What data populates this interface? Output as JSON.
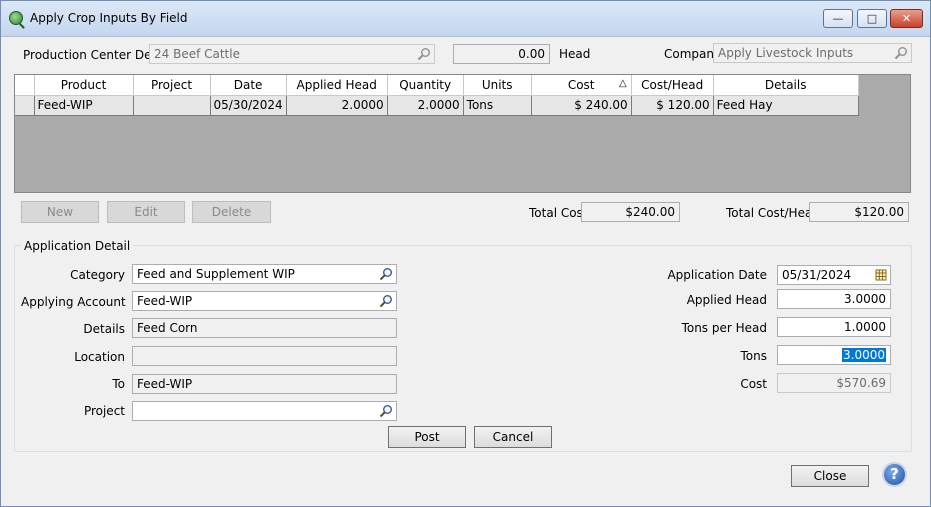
{
  "window": {
    "title": "Apply Crop Inputs By Field"
  },
  "header": {
    "production_center_label": "Production Center Detail",
    "production_center_value": "24 Beef Cattle",
    "head_value": "0.00",
    "head_label": "Head",
    "company_label": "Company",
    "company_value": "Apply Livestock Inputs"
  },
  "grid": {
    "columns": [
      "Product",
      "Project",
      "Date",
      "Applied Head",
      "Quantity",
      "Units",
      "Cost",
      "Cost/Head",
      "Details"
    ],
    "rows": [
      [
        "Feed-WIP",
        "",
        "05/30/2024",
        "2.0000",
        "2.0000",
        "Tons",
        "$ 240.00",
        "$ 120.00",
        "Feed Hay"
      ]
    ]
  },
  "actions": {
    "new_label": "New",
    "edit_label": "Edit",
    "delete_label": "Delete"
  },
  "totals": {
    "total_cost_label": "Total Cost",
    "total_cost_value": "$240.00",
    "total_cost_head_label": "Total Cost/Head",
    "total_cost_head_value": "$120.00"
  },
  "detail": {
    "legend": "Application Detail",
    "category_label": "Category",
    "category_value": "Feed and Supplement WIP",
    "applying_account_label": "Applying Account",
    "applying_account_value": "Feed-WIP",
    "details_label": "Details",
    "details_value": "Feed Corn",
    "location_label": "Location",
    "location_value": "",
    "to_label": "To",
    "to_value": "Feed-WIP",
    "project_label": "Project",
    "project_value": "",
    "application_date_label": "Application Date",
    "application_date_value": "05/31/2024",
    "applied_head_label": "Applied Head",
    "applied_head_value": "3.0000",
    "tons_per_head_label": "Tons per Head",
    "tons_per_head_value": "1.0000",
    "tons_label": "Tons",
    "tons_value": "3.0000",
    "cost_label": "Cost",
    "cost_value": "$570.69",
    "post_label": "Post",
    "cancel_label": "Cancel"
  },
  "footer": {
    "close_label": "Close",
    "help_glyph": "?"
  }
}
